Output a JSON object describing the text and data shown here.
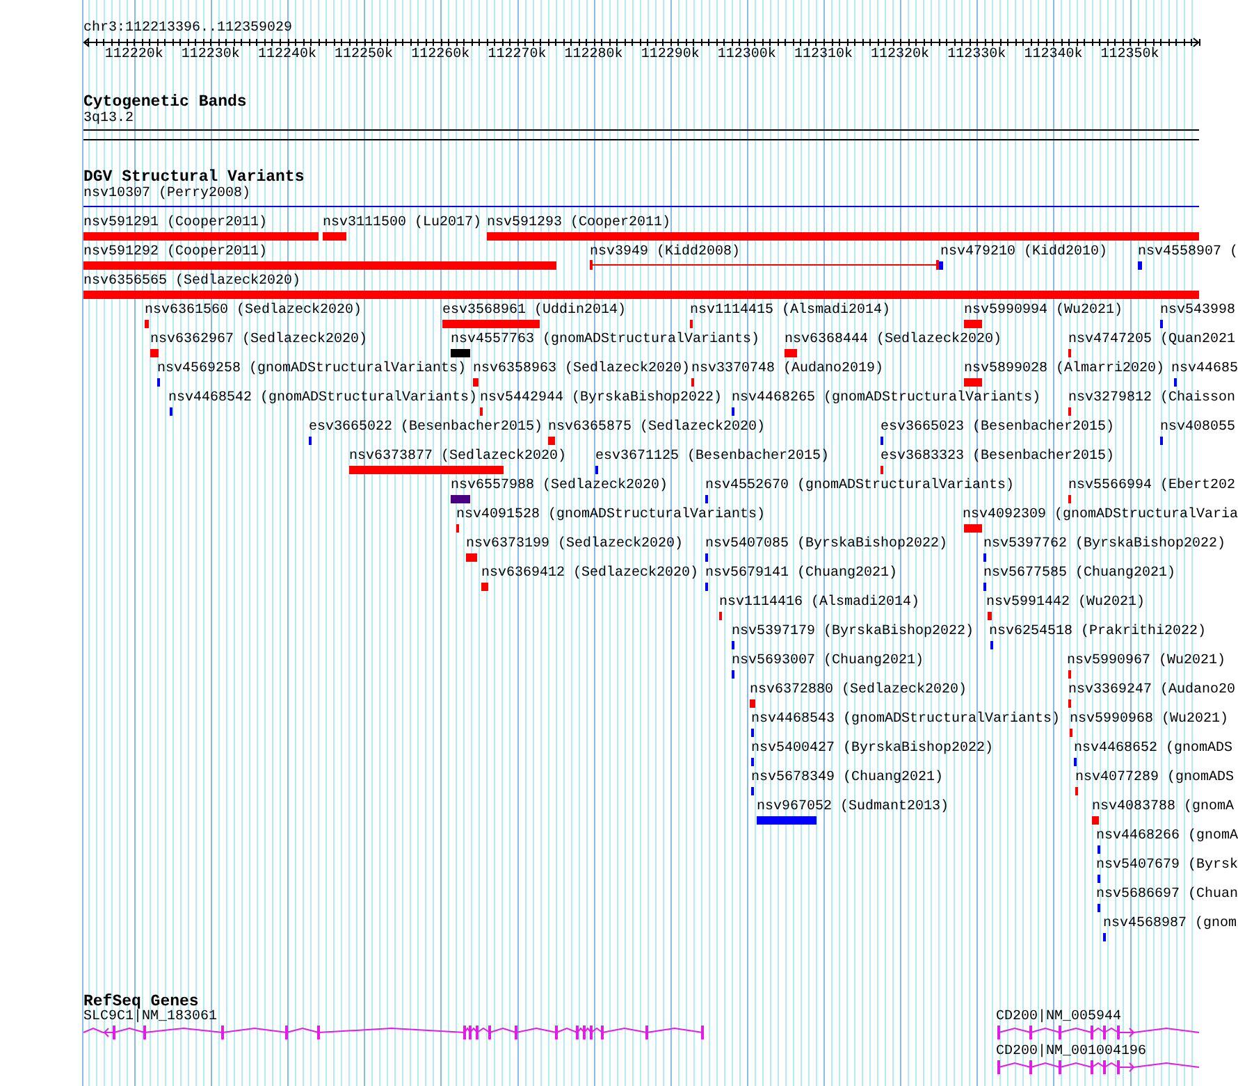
{
  "ruler": {
    "location": "chr3:112213396..112359029",
    "ticks": [
      "112220k",
      "112230k",
      "112240k",
      "112250k",
      "112260k",
      "112270k",
      "112280k",
      "112290k",
      "112300k",
      "112310k",
      "112320k",
      "112330k",
      "112340k",
      "112350k"
    ]
  },
  "tracks": [
    {
      "kind": "cytobands",
      "title": "Cytogenetic Bands",
      "features": [
        {
          "label": "3q13.2"
        }
      ]
    },
    {
      "kind": "variants",
      "title": "DGV Structural Variants",
      "features": [
        {
          "label": "nsv10307 (Perry2008)",
          "kind": "line",
          "color": "#0000ff"
        },
        {
          "label": "nsv591291 (Cooper2011)",
          "kind": "bar",
          "color": "#ff0000"
        },
        {
          "label": "nsv3111500 (Lu2017)",
          "kind": "bar",
          "color": "#ff0000"
        },
        {
          "label": "nsv591293 (Cooper2011)",
          "kind": "bar",
          "color": "#ff0000"
        },
        {
          "label": "nsv591292 (Cooper2011)",
          "kind": "bar",
          "color": "#ff0000"
        },
        {
          "label": "nsv3949 (Kidd2008)",
          "kind": "line",
          "color": "#ff0000"
        },
        {
          "label": "nsv479210 (Kidd2010)",
          "kind": "bar",
          "color": "#0000ff"
        },
        {
          "label": "nsv4558907 (",
          "kind": "bar",
          "color": "#0000ff"
        },
        {
          "label": "nsv6356565 (Sedlazeck2020)",
          "kind": "bar",
          "color": "#ff0000"
        },
        {
          "label": "nsv6361560 (Sedlazeck2020)",
          "kind": "bar",
          "color": "#ff0000"
        },
        {
          "label": "esv3568961 (Uddin2014)",
          "kind": "bar",
          "color": "#ff0000"
        },
        {
          "label": "nsv1114415 (Alsmadi2014)",
          "kind": "bar",
          "color": "#ff0000"
        },
        {
          "label": "nsv5990994 (Wu2021)",
          "kind": "bar",
          "color": "#ff0000"
        },
        {
          "label": "nsv543998",
          "kind": "bar",
          "color": "#0000ff"
        },
        {
          "label": "nsv6362967 (Sedlazeck2020)",
          "kind": "bar",
          "color": "#ff0000"
        },
        {
          "label": "nsv4557763 (gnomADStructuralVariants)",
          "kind": "bar",
          "color": "#000000"
        },
        {
          "label": "nsv6368444 (Sedlazeck2020)",
          "kind": "bar",
          "color": "#ff0000"
        },
        {
          "label": "nsv4747205 (Quan2021",
          "kind": "bar",
          "color": "#ff0000"
        },
        {
          "label": "nsv4569258 (gnomADStructuralVariants)",
          "kind": "bar",
          "color": "#0000ff"
        },
        {
          "label": "nsv6358963 (Sedlazeck2020)",
          "kind": "bar",
          "color": "#ff0000"
        },
        {
          "label": "nsv3370748 (Audano2019)",
          "kind": "bar",
          "color": "#ff0000"
        },
        {
          "label": "nsv5899028 (Almarri2020)",
          "kind": "bar",
          "color": "#ff0000"
        },
        {
          "label": "nsv44685",
          "kind": "bar",
          "color": "#0000ff"
        },
        {
          "label": "nsv4468542 (gnomADStructuralVariants)",
          "kind": "bar",
          "color": "#0000ff"
        },
        {
          "label": "nsv5442944 (ByrskaBishop2022)",
          "kind": "bar",
          "color": "#ff0000"
        },
        {
          "label": "nsv4468265 (gnomADStructuralVariants)",
          "kind": "bar",
          "color": "#0000ff"
        },
        {
          "label": "nsv3279812 (Chaisson",
          "kind": "bar",
          "color": "#ff0000"
        },
        {
          "label": "esv3665022 (Besenbacher2015)",
          "kind": "bar",
          "color": "#0000ff"
        },
        {
          "label": "nsv6365875 (Sedlazeck2020)",
          "kind": "bar",
          "color": "#ff0000"
        },
        {
          "label": "esv3665023 (Besenbacher2015)",
          "kind": "bar",
          "color": "#0000ff"
        },
        {
          "label": "nsv408055",
          "kind": "bar",
          "color": "#0000ff"
        },
        {
          "label": "nsv6373877 (Sedlazeck2020)",
          "kind": "bar",
          "color": "#ff0000"
        },
        {
          "label": "esv3671125 (Besenbacher2015)",
          "kind": "bar",
          "color": "#0000ff"
        },
        {
          "label": "esv3683323 (Besenbacher2015)",
          "kind": "bar",
          "color": "#ff0000"
        },
        {
          "label": "nsv6557988 (Sedlazeck2020)",
          "kind": "bar",
          "color": "#4b0082"
        },
        {
          "label": "nsv4552670 (gnomADStructuralVariants)",
          "kind": "bar",
          "color": "#0000ff"
        },
        {
          "label": "nsv5566994 (Ebert202",
          "kind": "bar",
          "color": "#ff0000"
        },
        {
          "label": "nsv4091528 (gnomADStructuralVariants)",
          "kind": "bar",
          "color": "#ff0000"
        },
        {
          "label": "nsv4092309 (gnomADStructuralVaria",
          "kind": "bar",
          "color": "#ff0000"
        },
        {
          "label": "nsv6373199 (Sedlazeck2020)",
          "kind": "bar",
          "color": "#ff0000"
        },
        {
          "label": "nsv5407085 (ByrskaBishop2022)",
          "kind": "bar",
          "color": "#0000ff"
        },
        {
          "label": "nsv5397762 (ByrskaBishop2022)",
          "kind": "bar",
          "color": "#0000ff"
        },
        {
          "label": "nsv6369412 (Sedlazeck2020)",
          "kind": "bar",
          "color": "#ff0000"
        },
        {
          "label": "nsv5679141 (Chuang2021)",
          "kind": "bar",
          "color": "#0000ff"
        },
        {
          "label": "nsv5677585 (Chuang2021)",
          "kind": "bar",
          "color": "#0000ff"
        },
        {
          "label": "nsv1114416 (Alsmadi2014)",
          "kind": "bar",
          "color": "#ff0000"
        },
        {
          "label": "nsv5991442 (Wu2021)",
          "kind": "bar",
          "color": "#ff0000"
        },
        {
          "label": "nsv5397179 (ByrskaBishop2022)",
          "kind": "bar",
          "color": "#0000ff"
        },
        {
          "label": "nsv6254518 (Prakrithi2022)",
          "kind": "bar",
          "color": "#0000ff"
        },
        {
          "label": "nsv5693007 (Chuang2021)",
          "kind": "bar",
          "color": "#0000ff"
        },
        {
          "label": "nsv5990967 (Wu2021)",
          "kind": "bar",
          "color": "#ff0000"
        },
        {
          "label": "nsv6372880 (Sedlazeck2020)",
          "kind": "bar",
          "color": "#ff0000"
        },
        {
          "label": "nsv3369247 (Audano20",
          "kind": "bar",
          "color": "#ff0000"
        },
        {
          "label": "nsv4468543 (gnomADStructuralVariants)",
          "kind": "bar",
          "color": "#0000ff"
        },
        {
          "label": "nsv5990968 (Wu2021)",
          "kind": "bar",
          "color": "#ff0000"
        },
        {
          "label": "nsv5400427 (ByrskaBishop2022)",
          "kind": "bar",
          "color": "#0000ff"
        },
        {
          "label": "nsv4468652 (gnomADS",
          "kind": "bar",
          "color": "#0000ff"
        },
        {
          "label": "nsv5678349 (Chuang2021)",
          "kind": "bar",
          "color": "#0000ff"
        },
        {
          "label": "nsv4077289 (gnomADS",
          "kind": "bar",
          "color": "#ff0000"
        },
        {
          "label": "nsv967052 (Sudmant2013)",
          "kind": "bar",
          "color": "#0000ff"
        },
        {
          "label": "nsv4083788 (gnomA",
          "kind": "bar",
          "color": "#ff0000"
        },
        {
          "label": "nsv4468266 (gnomA",
          "kind": "bar",
          "color": "#0000ff"
        },
        {
          "label": "nsv5407679 (Byrsk",
          "kind": "bar",
          "color": "#0000ff"
        },
        {
          "label": "nsv5686697 (Chuan",
          "kind": "bar",
          "color": "#0000ff"
        },
        {
          "label": "nsv4568987 (gnom",
          "kind": "bar",
          "color": "#0000ff"
        }
      ]
    },
    {
      "kind": "genes",
      "title": "RefSeq Genes",
      "features": [
        {
          "label": "SLC9C1|NM_183061",
          "reverse_strand": true
        },
        {
          "label": "CD200|NM_005944",
          "reverse_strand": false
        },
        {
          "label": "CD200|NM_001004196",
          "reverse_strand": false
        }
      ]
    }
  ]
}
